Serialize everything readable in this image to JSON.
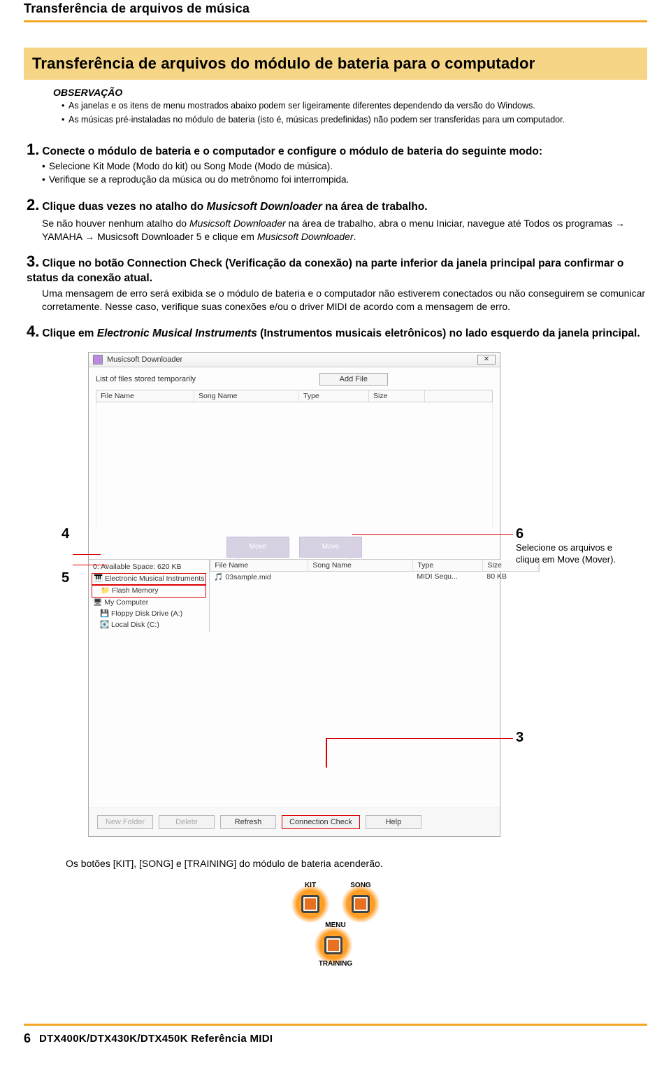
{
  "header": {
    "breadcrumb": "Transferência de arquivos de música",
    "section_title": "Transferência de arquivos do módulo de bateria para o computador"
  },
  "observacao": {
    "title": "OBSERVAÇÃO",
    "items": [
      "As janelas e os itens de menu mostrados abaixo podem ser ligeiramente diferentes dependendo da versão do Windows.",
      "As músicas pré-instaladas no módulo de bateria (isto é, músicas predefinidas) não podem ser transferidas para um computador."
    ]
  },
  "steps": {
    "s1": {
      "num": "1.",
      "head": "Conecte o módulo de bateria e o computador e configure o módulo de bateria do seguinte modo:",
      "bullets": [
        "Selecione Kit Mode (Modo do kit) ou Song Mode (Modo de música).",
        "Verifique se a reprodução da música ou do metrônomo foi interrompida."
      ]
    },
    "s2": {
      "num": "2.",
      "head_a": "Clique duas vezes no atalho do ",
      "head_i": "Musicsoft Downloader",
      "head_b": " na área de trabalho.",
      "body_a": "Se não houver nenhum atalho do ",
      "body_i1": "Musicsoft Downloader",
      "body_b": " na área de trabalho, abra o menu Iniciar, navegue até Todos os programas → YAMAHA → Musicsoft Downloader 5 e clique em ",
      "body_i2": "Musicsoft Downloader",
      "body_c": "."
    },
    "s3": {
      "num": "3.",
      "head": "Clique no botão Connection Check (Verificação da conexão) na parte inferior da janela principal para confirmar o status da conexão atual.",
      "body": "Uma mensagem de erro será exibida se o módulo de bateria e o computador não estiverem conectados ou não conseguirem se comunicar corretamente. Nesse caso, verifique suas conexões e/ou o driver MIDI de acordo com a mensagem de erro."
    },
    "s4": {
      "num": "4.",
      "head_a": "Clique em ",
      "head_i": "Electronic Musical Instruments",
      "head_b": " (Instrumentos musicais eletrônicos) no lado esquerdo da janela principal."
    }
  },
  "screenshot": {
    "title": "Musicsoft Downloader",
    "close": "✕",
    "list_label": "List of files stored temporarily",
    "add_file": "Add File",
    "cols": {
      "file_name": "File Name",
      "song_name": "Song Name",
      "type": "Type",
      "size": "Size"
    },
    "move": "Move",
    "tree": {
      "root": "0: Available Space: 620 KB",
      "emi": "Electronic Musical Instruments",
      "flash": "Flash Memory",
      "mycomp": "My Computer",
      "floppy": "Floppy Disk Drive (A:)",
      "local": "Local Disk (C:)"
    },
    "file": {
      "name": "03sample.mid",
      "type": "MIDI Sequ...",
      "size": "80 KB"
    },
    "buttons": {
      "new_folder": "New Folder",
      "delete": "Delete",
      "refresh": "Refresh",
      "conn_check": "Connection Check",
      "help": "Help"
    }
  },
  "callouts": {
    "c4": "4",
    "c5": "5",
    "c6": "6",
    "c6_text": "Selecione os arquivos e clique em Move (Mover).",
    "c3": "3"
  },
  "after": {
    "note": "Os botões [KIT], [SONG] e [TRAINING] do módulo de bateria acenderão."
  },
  "module": {
    "kit": "KIT",
    "song": "SONG",
    "menu": "MENU",
    "training": "TRAINING"
  },
  "footer": {
    "page": "6",
    "title": "DTX400K/DTX430K/DTX450K  Referência MIDI"
  }
}
